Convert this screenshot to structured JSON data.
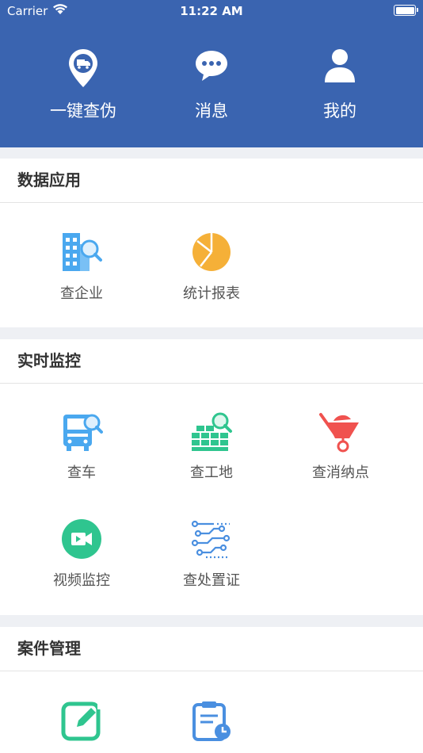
{
  "status_bar": {
    "carrier": "Carrier",
    "time": "11:22 AM"
  },
  "top_nav": [
    {
      "label": "一键查伪",
      "icon": "truck-location-icon"
    },
    {
      "label": "消息",
      "icon": "chat-bubble-icon"
    },
    {
      "label": "我的",
      "icon": "user-icon"
    }
  ],
  "sections": [
    {
      "title": "数据应用",
      "items": [
        {
          "label": "查企业",
          "icon": "building-search-icon"
        },
        {
          "label": "统计报表",
          "icon": "pie-chart-icon"
        }
      ]
    },
    {
      "title": "实时监控",
      "items": [
        {
          "label": "查车",
          "icon": "truck-search-icon"
        },
        {
          "label": "查工地",
          "icon": "construction-search-icon"
        },
        {
          "label": "查消纳点",
          "icon": "wheelbarrow-icon"
        },
        {
          "label": "视频监控",
          "icon": "video-camera-icon"
        },
        {
          "label": "查处置证",
          "icon": "circuit-icon"
        }
      ]
    },
    {
      "title": "案件管理",
      "items": [
        {
          "label": "",
          "icon": "edit-icon"
        },
        {
          "label": "",
          "icon": "clipboard-clock-icon"
        }
      ]
    }
  ],
  "colors": {
    "header_bg": "#3a64b0",
    "blue": "#4a90e2",
    "orange": "#f5a623",
    "green": "#2fc58f",
    "red": "#f0524f"
  }
}
